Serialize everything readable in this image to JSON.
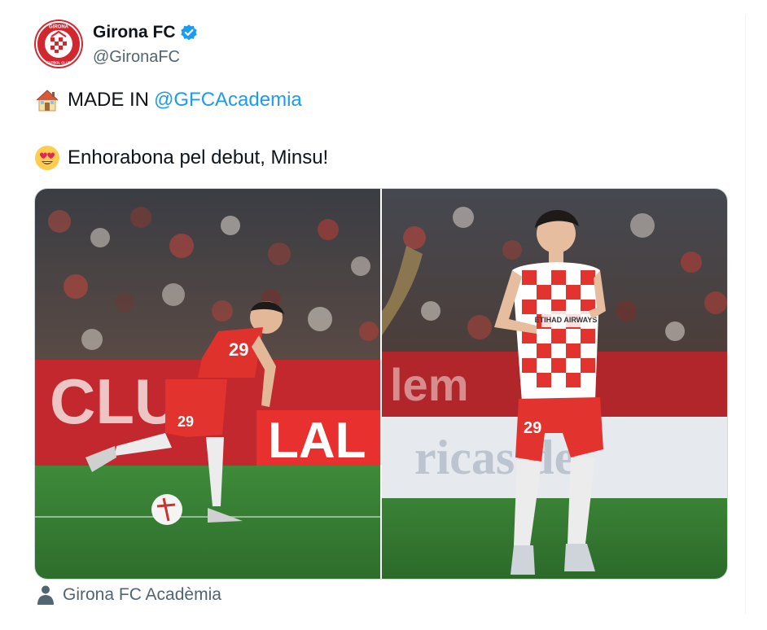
{
  "account": {
    "display_name": "Girona FC",
    "handle": "@GironaFC",
    "verified": true,
    "avatar_text_top": "GIRONA",
    "avatar_text_bottom": "FUTBOL CLUB"
  },
  "tweet": {
    "line1_emoji": "house-emoji",
    "line1_text": "MADE IN",
    "line1_mention": "@GFCAcademia",
    "line2_emoji": "heart-eyes-emoji",
    "line2_text": "Enhorabona pel debut, Minsu!"
  },
  "media": {
    "photo_left": {
      "banner_left": "CLUB",
      "banner_right": "LAL",
      "shirt_number": "29"
    },
    "photo_right": {
      "board_top": "lem",
      "board_bottom": "ricas de",
      "sponsor": "ETIHAD AIRWAYS",
      "shirt_number": "29"
    }
  },
  "tagged": {
    "icon": "person-icon",
    "label": "Girona FC Acadèmia"
  },
  "colors": {
    "accent": "#1d9bf0",
    "secondary_text": "#536471",
    "brand_red": "#d2272f"
  }
}
